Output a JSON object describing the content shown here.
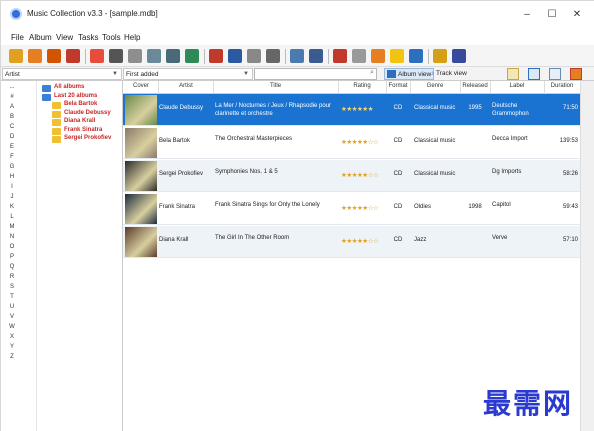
{
  "window": {
    "title": "Music Collection v3.3 - [sample.mdb]",
    "controls": [
      "–",
      "☐",
      "✕"
    ]
  },
  "menu": [
    "File",
    "Album",
    "View",
    "Tasks",
    "Tools",
    "Help"
  ],
  "filter": {
    "field": "Artist",
    "sort": "First added",
    "search_value": ""
  },
  "views": {
    "album_view": "Album view",
    "track_view": "Track view"
  },
  "alphabet": [
    "...",
    "#",
    "A",
    "B",
    "C",
    "D",
    "E",
    "F",
    "G",
    "H",
    "I",
    "J",
    "K",
    "L",
    "M",
    "N",
    "O",
    "P",
    "Q",
    "R",
    "S",
    "T",
    "U",
    "V",
    "W",
    "X",
    "Y",
    "Z"
  ],
  "tree": [
    {
      "label": "All albums",
      "icon": "library-icon",
      "color": "#3b7fd9"
    },
    {
      "label": "Last 20 albums",
      "icon": "folder-icon",
      "color": "#3b7fd9"
    },
    {
      "label": "Bela Bartok",
      "icon": "folder-icon",
      "color": "#f0c030"
    },
    {
      "label": "Claude Debussy",
      "icon": "folder-icon",
      "color": "#f0c030"
    },
    {
      "label": "Diana Krall",
      "icon": "folder-icon",
      "color": "#f0c030"
    },
    {
      "label": "Frank Sinatra",
      "icon": "folder-icon",
      "color": "#f0c030"
    },
    {
      "label": "Sergei Prokofiev",
      "icon": "folder-icon",
      "color": "#f0c030"
    }
  ],
  "columns": [
    "Cover",
    "Artist",
    "Title",
    "Rating",
    "Format",
    "Genre",
    "Released",
    "Label",
    "Duration"
  ],
  "albums": [
    {
      "artist": "Claude Debussy",
      "title": "La Mer / Nocturnes / Jeux / Rhapsodie pour clarinette et orchestre",
      "rating": "★★★★★★",
      "format": "CD",
      "genre": "Classical music",
      "released": "1995",
      "label": "Deutsche Grammophon",
      "duration": "71:50",
      "cover_color": "#6a8a4a"
    },
    {
      "artist": "Bela Bartok",
      "title": "The Orchestral Masterpieces",
      "rating": "★★★★★☆☆",
      "format": "CD",
      "genre": "Classical music",
      "released": "",
      "label": "Decca Import",
      "duration": "139:53",
      "cover_color": "#8a7a6a"
    },
    {
      "artist": "Sergei Prokofiev",
      "title": "Symphonies Nos. 1 & 5",
      "rating": "★★★★★☆☆",
      "format": "CD",
      "genre": "Classical music",
      "released": "",
      "label": "Dg Imports",
      "duration": "58:26",
      "cover_color": "#2a2a2a"
    },
    {
      "artist": "Frank Sinatra",
      "title": "Frank Sinatra Sings for Only the Lonely",
      "rating": "★★★★★☆☆",
      "format": "CD",
      "genre": "Oldies",
      "released": "1998",
      "label": "Capitol",
      "duration": "59:43",
      "cover_color": "#1c2a3c"
    },
    {
      "artist": "Diana Krall",
      "title": "The Girl In The Other Room",
      "rating": "★★★★★☆☆",
      "format": "CD",
      "genre": "Jazz",
      "released": "",
      "label": "Verve",
      "duration": "57:10",
      "cover_color": "#5a3a2a"
    }
  ],
  "watermark": "最需网",
  "accent_color": "#1a73d1"
}
